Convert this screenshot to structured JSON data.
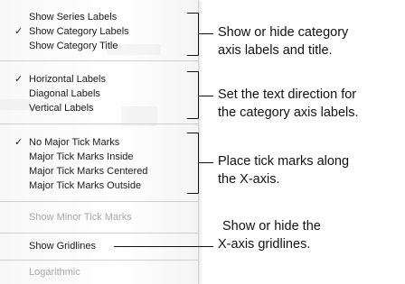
{
  "menu": {
    "groups": [
      {
        "items": [
          {
            "label": "Show Series Labels",
            "checked": false,
            "enabled": true
          },
          {
            "label": "Show Category Labels",
            "checked": true,
            "enabled": true
          },
          {
            "label": "Show Category Title",
            "checked": false,
            "enabled": true
          }
        ]
      },
      {
        "items": [
          {
            "label": "Horizontal Labels",
            "checked": true,
            "enabled": true
          },
          {
            "label": "Diagonal Labels",
            "checked": false,
            "enabled": true
          },
          {
            "label": "Vertical Labels",
            "checked": false,
            "enabled": true
          }
        ]
      },
      {
        "items": [
          {
            "label": "No Major Tick Marks",
            "checked": true,
            "enabled": true
          },
          {
            "label": "Major Tick Marks Inside",
            "checked": false,
            "enabled": true
          },
          {
            "label": "Major Tick Marks Centered",
            "checked": false,
            "enabled": true
          },
          {
            "label": "Major Tick Marks Outside",
            "checked": false,
            "enabled": true
          }
        ]
      },
      {
        "items": [
          {
            "label": "Show Minor Tick Marks",
            "checked": false,
            "enabled": false
          }
        ]
      },
      {
        "items": [
          {
            "label": "Show Gridlines",
            "checked": false,
            "enabled": true
          }
        ]
      },
      {
        "items": [
          {
            "label": "Logarithmic",
            "checked": false,
            "enabled": false
          }
        ]
      }
    ],
    "check_glyph": "✓"
  },
  "callouts": {
    "labels_title": {
      "line1": "Show or hide category",
      "line2": "axis labels and title."
    },
    "text_direction": {
      "line1": "Set the text direction for",
      "line2": "the category axis labels."
    },
    "tick_marks": {
      "line1": "Place tick marks along",
      "line2": "the X-axis."
    },
    "gridlines": {
      "line1": "Show or hide the",
      "line2": "X-axis gridlines."
    }
  },
  "colors": {
    "text": "#1a1a1a",
    "disabled_text": "#a8a8a8",
    "separator": "#cfcfcf",
    "callout_line": "#111111"
  }
}
